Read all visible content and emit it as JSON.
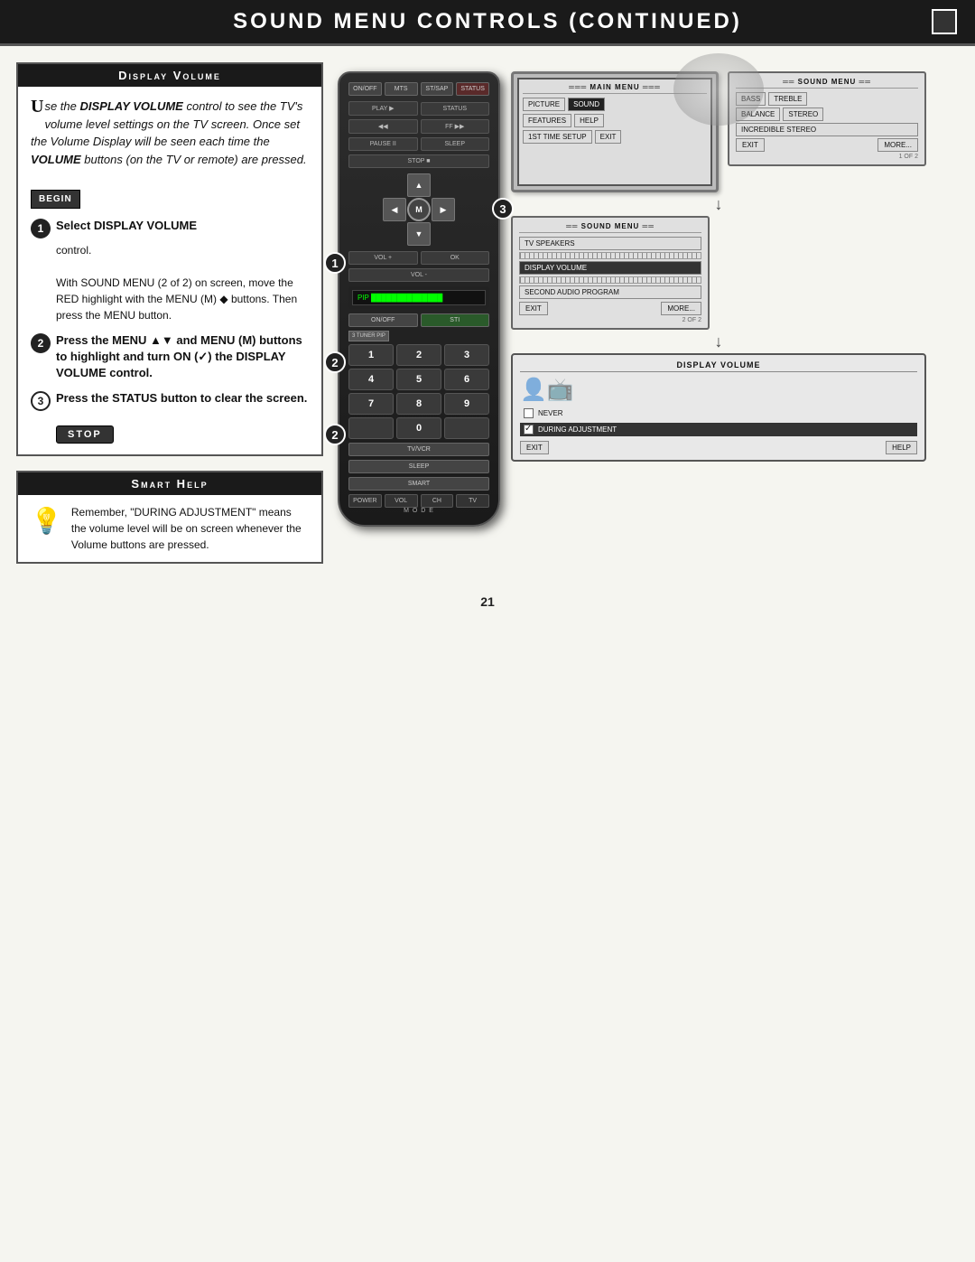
{
  "header": {
    "title": "Sound Menu Controls (Continued)",
    "box_decoration": ""
  },
  "display_volume_section": {
    "header": "Display Volume",
    "intro": {
      "drop_cap": "U",
      "text": "se the DISPLAY VOLUME control to see the TV's volume level settings on the TV screen. Once set the Volume Display will be seen each time the VOLUME buttons (on the TV or remote) are pressed."
    },
    "begin_badge": "BEGIN",
    "steps": [
      {
        "number": "1",
        "title": "Select DISPLAY VOLUME",
        "body": "control.",
        "extra": "With SOUND MENU (2 of 2) on screen, move the RED highlight with the MENU (M) ◆ buttons. Then press the MENU button."
      },
      {
        "number": "2",
        "title": "Press the MENU ▲▼ and MENU (M) buttons",
        "body": "to highlight and turn ON (✓) the DISPLAY VOLUME control."
      },
      {
        "number": "3",
        "title": "Press the STATUS button",
        "body": "to clear the screen."
      }
    ],
    "stop_badge": "STOP"
  },
  "smart_help": {
    "header": "Smart Help",
    "text": "Remember, \"DURING ADJUSTMENT\" means the volume level will be on screen whenever the Volume buttons are pressed."
  },
  "remote": {
    "screen_label": "PIP",
    "top_buttons": [
      "ON/OFF",
      "MTS",
      "ST/SAP",
      "STATUS"
    ],
    "play_row": [
      "PLAY▶",
      "STATUS"
    ],
    "rewind": "◀◀",
    "ff": "▶▶",
    "pause": "PAUSE II",
    "stop": "STOP ■",
    "sleep": "SLEEP",
    "dpad": {
      "up": "▲",
      "down": "▼",
      "left": "◀",
      "right": "▶",
      "center": "M"
    },
    "vol_label": "VOL",
    "ch_label": "CH",
    "num_pad": [
      "1",
      "2",
      "3",
      "4",
      "5",
      "6",
      "7",
      "8",
      "9",
      "0"
    ],
    "bottom_buttons": [
      "POWER",
      "VOL",
      "CH",
      "TV"
    ],
    "mode_label": "M O D E",
    "3_tuner": "3 TUNER PIP",
    "tv_vcr": "TV/VCR",
    "sleep_btn": "SLEEP",
    "smart": "SMART"
  },
  "tv_screens": {
    "main_menu": {
      "title": "MAIN MENU",
      "items": [
        "PICTURE",
        "SOUND",
        "FEATURES",
        "HELP",
        "1ST TIME SETUP",
        "EXIT"
      ],
      "highlight": "SOUND"
    },
    "sound_menu_1": {
      "title": "SOUND MENU",
      "items": [
        "BASS",
        "TREBLE",
        "BALANCE",
        "STEREO",
        "INCREDIBLE STEREO",
        "EXIT",
        "MORE..."
      ],
      "page": "1 OF 2"
    },
    "sound_menu_2": {
      "title": "SOUND MENU",
      "items": [
        "TV SPEAKERS",
        "DISPLAY VOLUME",
        "SECOND AUDIO PROGRAM",
        "EXIT",
        "MORE..."
      ],
      "page": "2 OF 2",
      "highlight": "DISPLAY VOLUME"
    },
    "display_volume_screen": {
      "title": "DISPLAY VOLUME",
      "options": [
        "NEVER",
        "DURING ADJUSTMENT"
      ],
      "checked": "DURING ADJUSTMENT"
    }
  },
  "page_number": "21"
}
